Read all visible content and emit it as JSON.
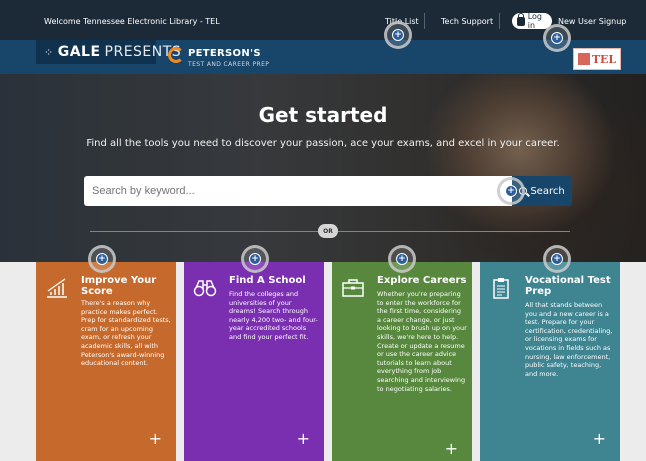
{
  "topbar": {
    "welcome": "Welcome Tennessee Electronic Library - TEL",
    "title_list": "Title List",
    "tech_support": "Tech Support",
    "login": "Log in",
    "signup": "New User Signup"
  },
  "brand": {
    "gale_bold": "GALE",
    "gale_light": "PRESENTS",
    "petersons_name": "PETERSON'S",
    "petersons_sub": "TEST AND CAREER PREP",
    "tel_text": "TEL"
  },
  "hero": {
    "title": "Get started",
    "subtitle": "Find all the tools you need to discover your passion, ace your exams, and excel in your career.",
    "search_placeholder": "Search by keyword...",
    "search_button": "Search",
    "or_label": "OR"
  },
  "cards": [
    {
      "title": "Improve Your Score",
      "description": "There's a reason why practice makes perfect. Prep for standardized tests, cram for an upcoming exam, or refresh your academic skills, all with Peterson's award-winning educational content.",
      "plus": "+",
      "icon": "chart-growth-icon",
      "color": "#c56a2c"
    },
    {
      "title": "Find A School",
      "description": "Find the colleges and universities of your dreams! Search through nearly 4,200 two- and four-year accredited schools and find your perfect fit.",
      "plus": "+",
      "icon": "binoculars-icon",
      "color": "#7a2fb0"
    },
    {
      "title": "Explore Careers",
      "description": "Whether you're preparing to enter the workforce for the first time, considering a career change, or just looking to brush up on your skills, we're here to help. Create or update a resume or use the career advice tutorials to learn about everything from job searching and interviewing to negotiating salaries.",
      "plus": "+",
      "icon": "briefcase-icon",
      "color": "#57883d"
    },
    {
      "title": "Vocational Test Prep",
      "description": "All that stands between you and a new career is a test. Prepare for your certification, credentialing, or licensing exams for vocations in fields such as nursing, law enforcement, public safety, teaching, and more.",
      "plus": "+",
      "icon": "clipboard-icon",
      "color": "#3e8491"
    }
  ]
}
